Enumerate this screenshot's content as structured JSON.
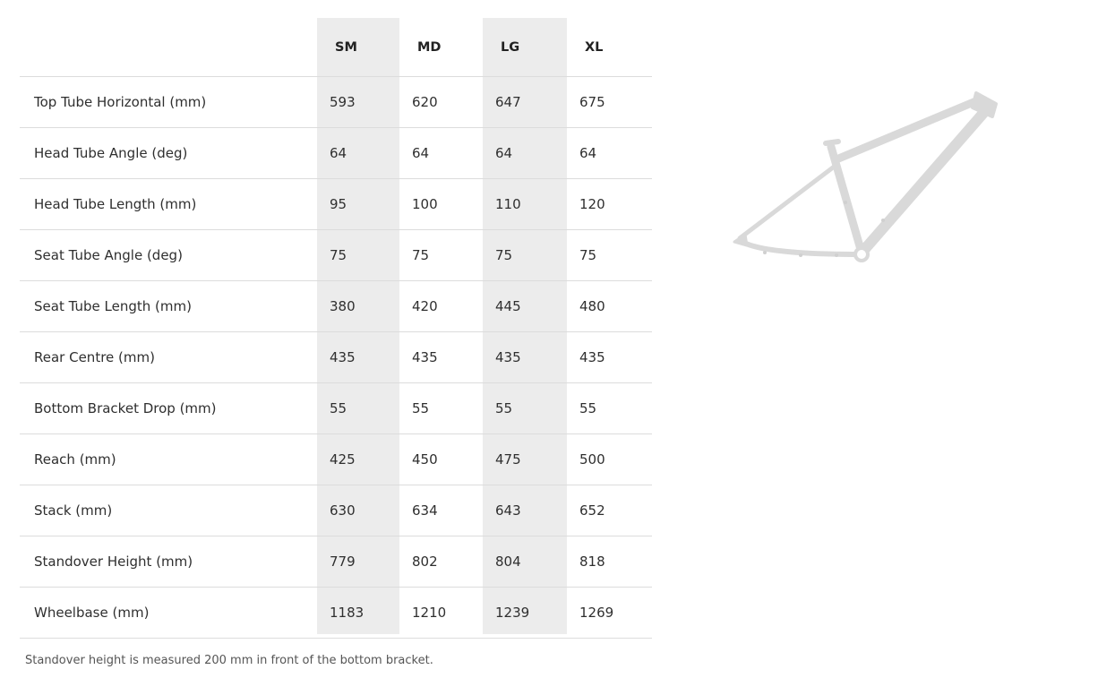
{
  "table": {
    "size_headers": [
      "SM",
      "MD",
      "LG",
      "XL"
    ],
    "rows": [
      {
        "label": "Top Tube Horizontal (mm)",
        "values": [
          "593",
          "620",
          "647",
          "675"
        ]
      },
      {
        "label": "Head Tube Angle (deg)",
        "values": [
          "64",
          "64",
          "64",
          "64"
        ]
      },
      {
        "label": "Head Tube Length (mm)",
        "values": [
          "95",
          "100",
          "110",
          "120"
        ]
      },
      {
        "label": "Seat Tube Angle (deg)",
        "values": [
          "75",
          "75",
          "75",
          "75"
        ]
      },
      {
        "label": "Seat Tube Length (mm)",
        "values": [
          "380",
          "420",
          "445",
          "480"
        ]
      },
      {
        "label": "Rear Centre (mm)",
        "values": [
          "435",
          "435",
          "435",
          "435"
        ]
      },
      {
        "label": "Bottom Bracket Drop (mm)",
        "values": [
          "55",
          "55",
          "55",
          "55"
        ]
      },
      {
        "label": "Reach (mm)",
        "values": [
          "425",
          "450",
          "475",
          "500"
        ]
      },
      {
        "label": "Stack (mm)",
        "values": [
          "630",
          "634",
          "643",
          "652"
        ]
      },
      {
        "label": "Standover Height (mm)",
        "values": [
          "779",
          "802",
          "804",
          "818"
        ]
      },
      {
        "label": "Wheelbase (mm)",
        "values": [
          "1183",
          "1210",
          "1239",
          "1269"
        ]
      }
    ]
  },
  "footnote": "Standover height is measured 200 mm in front of the bottom bracket.",
  "colors": {
    "column_highlight": "#ececec",
    "row_divider": "#dcdcdc",
    "frame_graphic": "#d9d9d9"
  },
  "icons": {
    "frame": "bike-frame-icon"
  }
}
